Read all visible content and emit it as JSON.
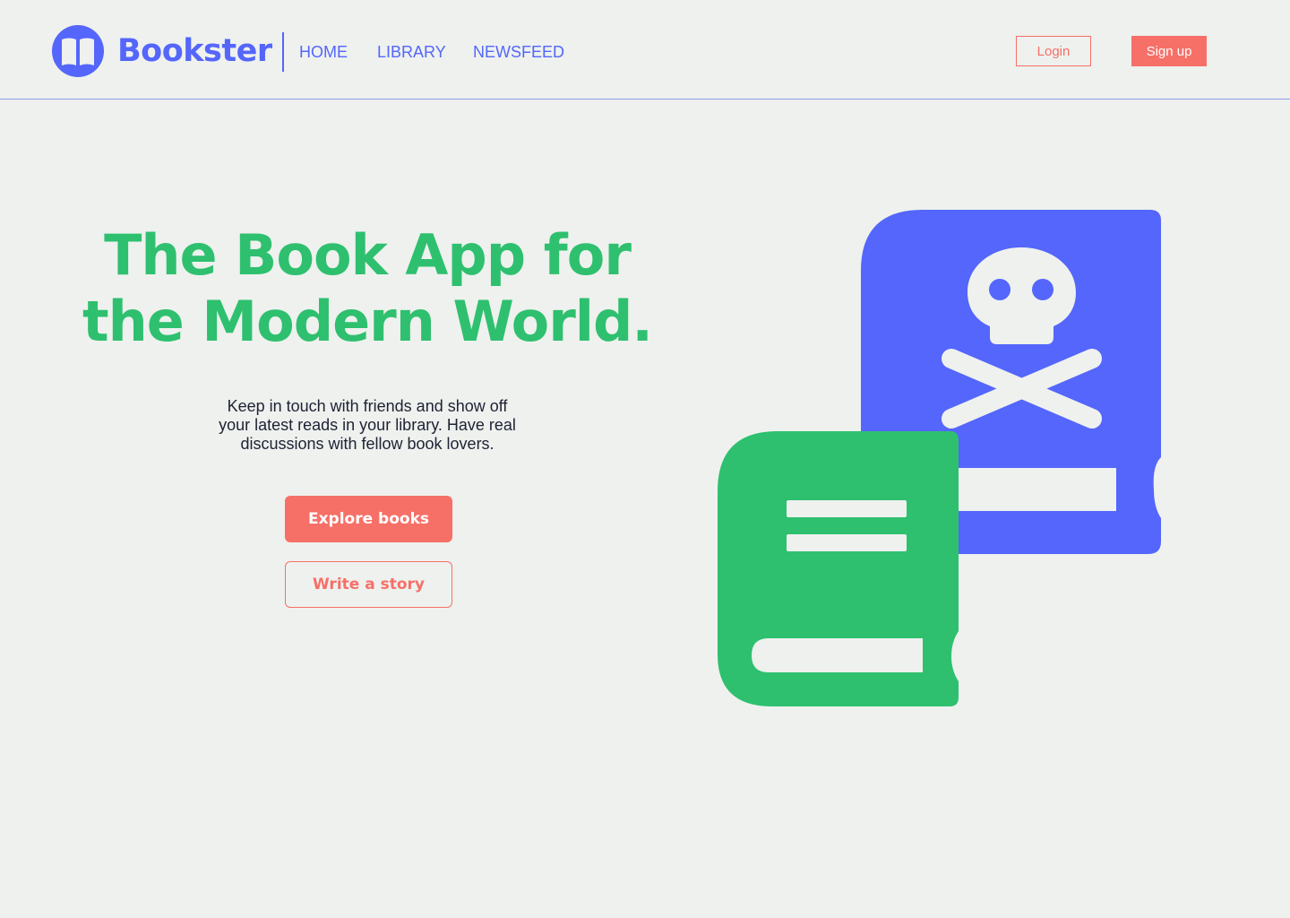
{
  "brand": {
    "name": "Bookster",
    "logo_icon": "open-book-icon",
    "color": "#5466fb"
  },
  "nav": {
    "items": [
      {
        "label": "HOME"
      },
      {
        "label": "LIBRARY"
      },
      {
        "label": "NEWSFEED"
      }
    ]
  },
  "auth": {
    "login_label": "Login",
    "signup_label": "Sign up"
  },
  "hero": {
    "title_line1": "The Book App for",
    "title_line2": "the Modern World.",
    "subtitle_line1": "Keep in touch with friends and show off",
    "subtitle_line2": "your latest reads in your library. Have real",
    "subtitle_line3": "discussions with fellow book lovers.",
    "primary_cta": "Explore books",
    "secondary_cta": "Write a story"
  },
  "illustration": {
    "back_book_icon": "skull-crossbones-book-icon",
    "front_book_icon": "book-icon"
  },
  "colors": {
    "background": "#eef1ee",
    "accent_blue": "#5466fb",
    "accent_green": "#2ec06f",
    "accent_coral": "#f67068",
    "text_dark": "#1f2233"
  }
}
